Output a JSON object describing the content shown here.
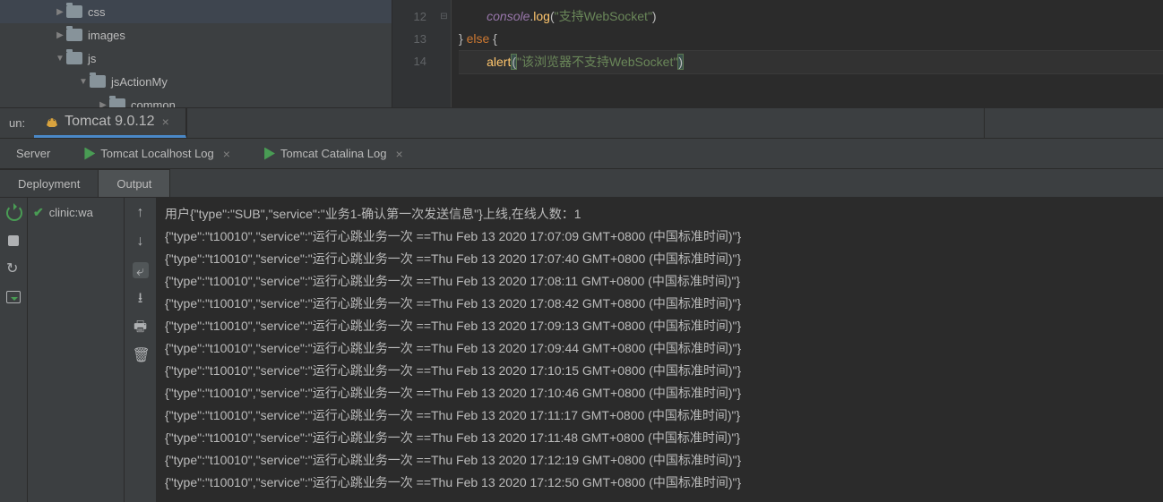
{
  "tree": {
    "items": [
      {
        "indent": 60,
        "arrow": "▶",
        "label": "css"
      },
      {
        "indent": 60,
        "arrow": "▶",
        "label": "images"
      },
      {
        "indent": 60,
        "arrow": "▼",
        "label": "js"
      },
      {
        "indent": 86,
        "arrow": "▼",
        "label": "jsActionMy"
      },
      {
        "indent": 108,
        "arrow": "▶",
        "label": "common"
      }
    ]
  },
  "editor": {
    "gutter": [
      "12",
      "13",
      "14"
    ],
    "fold": [
      "",
      "⊟",
      ""
    ],
    "lines": {
      "l12_indent": "        ",
      "l12_obj": "console",
      "l12_dot": ".",
      "l12_method": "log",
      "l12_open": "(",
      "l12_str": "\"支持WebSocket\"",
      "l12_close": ")",
      "l13_close_brace": "} ",
      "l13_else": "else",
      "l13_open_brace": " {",
      "l14_indent": "        ",
      "l14_func": "alert",
      "l14_p1": "(",
      "l14_str": "\"该浏览器不支持WebSocket\"",
      "l14_p2": ")"
    }
  },
  "run": {
    "label": "un:",
    "tab": "Tomcat 9.0.12"
  },
  "logTabs": {
    "server": "Server",
    "localhost": "Tomcat Localhost Log",
    "catalina": "Tomcat Catalina Log"
  },
  "subTabs": {
    "deployment": "Deployment",
    "output": "Output"
  },
  "deploy": {
    "item": "clinic:wa"
  },
  "console": {
    "lines": [
      "用户{\"type\":\"SUB\",\"service\":\"业务1-确认第一次发送信息\"}上线,在线人数：1",
      "{\"type\":\"t10010\",\"service\":\"运行心跳业务一次 ==Thu Feb 13 2020 17:07:09 GMT+0800 (中国标准时间)\"}",
      "{\"type\":\"t10010\",\"service\":\"运行心跳业务一次 ==Thu Feb 13 2020 17:07:40 GMT+0800 (中国标准时间)\"}",
      "{\"type\":\"t10010\",\"service\":\"运行心跳业务一次 ==Thu Feb 13 2020 17:08:11 GMT+0800 (中国标准时间)\"}",
      "{\"type\":\"t10010\",\"service\":\"运行心跳业务一次 ==Thu Feb 13 2020 17:08:42 GMT+0800 (中国标准时间)\"}",
      "{\"type\":\"t10010\",\"service\":\"运行心跳业务一次 ==Thu Feb 13 2020 17:09:13 GMT+0800 (中国标准时间)\"}",
      "{\"type\":\"t10010\",\"service\":\"运行心跳业务一次 ==Thu Feb 13 2020 17:09:44 GMT+0800 (中国标准时间)\"}",
      "{\"type\":\"t10010\",\"service\":\"运行心跳业务一次 ==Thu Feb 13 2020 17:10:15 GMT+0800 (中国标准时间)\"}",
      "{\"type\":\"t10010\",\"service\":\"运行心跳业务一次 ==Thu Feb 13 2020 17:10:46 GMT+0800 (中国标准时间)\"}",
      "{\"type\":\"t10010\",\"service\":\"运行心跳业务一次 ==Thu Feb 13 2020 17:11:17 GMT+0800 (中国标准时间)\"}",
      "{\"type\":\"t10010\",\"service\":\"运行心跳业务一次 ==Thu Feb 13 2020 17:11:48 GMT+0800 (中国标准时间)\"}",
      "{\"type\":\"t10010\",\"service\":\"运行心跳业务一次 ==Thu Feb 13 2020 17:12:19 GMT+0800 (中国标准时间)\"}",
      "{\"type\":\"t10010\",\"service\":\"运行心跳业务一次 ==Thu Feb 13 2020 17:12:50 GMT+0800 (中国标准时间)\"}"
    ]
  }
}
